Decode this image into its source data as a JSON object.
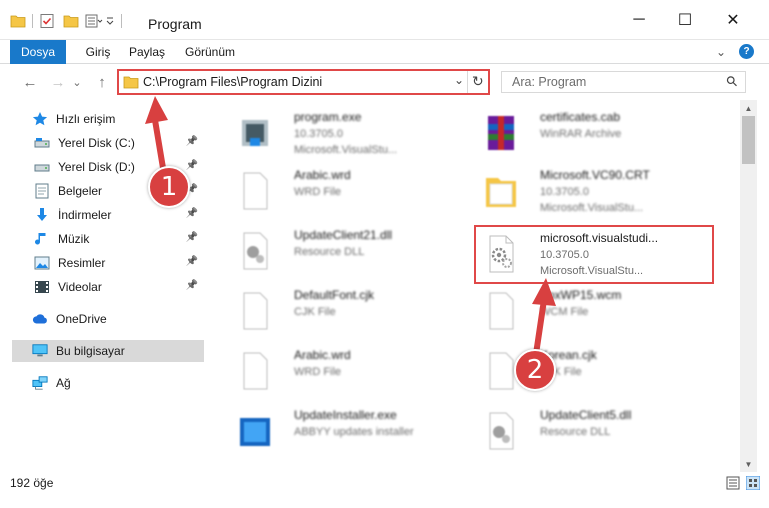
{
  "window": {
    "title": "Program",
    "minimize_glyph": "─",
    "maximize_glyph": "☐",
    "close_glyph": "✕"
  },
  "ribbon": {
    "tabs": [
      {
        "label": "Dosya"
      },
      {
        "label": "Giriş"
      },
      {
        "label": "Paylaş"
      },
      {
        "label": "Görünüm"
      }
    ],
    "help_glyph": "?",
    "collapse_glyph": "⌄"
  },
  "nav": {
    "back_glyph": "←",
    "forward_glyph": "→",
    "recent_glyph": "⌄",
    "up_glyph": "↑",
    "address": "C:\\Program Files\\Program Dizini",
    "dropdown_glyph": "⌄",
    "refresh_glyph": "↻",
    "search_placeholder": "Ara: Program",
    "search_glyph": "⚲"
  },
  "sidebar": {
    "quick_access": "Hızlı erişim",
    "items": [
      {
        "label": "Yerel Disk (C:)",
        "icon": "drive-icon"
      },
      {
        "label": "Yerel Disk (D:)",
        "icon": "drive-icon"
      },
      {
        "label": "Belgeler",
        "icon": "documents-icon"
      },
      {
        "label": "İndirmeler",
        "icon": "downloads-icon"
      },
      {
        "label": "Müzik",
        "icon": "music-icon"
      },
      {
        "label": "Resimler",
        "icon": "pictures-icon"
      },
      {
        "label": "Videolar",
        "icon": "videos-icon"
      }
    ],
    "onedrive": "OneDrive",
    "this_pc": "Bu bilgisayar",
    "network": "Ağ",
    "pin_glyph": "📌"
  },
  "files": [
    {
      "name": "program.exe",
      "line2": "10.3705.0",
      "line3": "Microsoft.VisualStu...",
      "icon": "exe-icon"
    },
    {
      "name": "certificates.cab",
      "line2": "WinRAR Archive",
      "line3": "",
      "icon": "archive-icon"
    },
    {
      "name": "Arabic.wrd",
      "line2": "WRD File",
      "line3": "",
      "icon": "file-icon"
    },
    {
      "name": "Microsoft.VC90.CRT",
      "line2": "10.3705.0",
      "line3": "Microsoft.VisualStu...",
      "icon": "folder-icon"
    },
    {
      "name": "UpdateClient21.dll",
      "line2": "Resource DLL",
      "line3": "",
      "icon": "dll-icon"
    },
    {
      "name": "microsoft.visualstudi...",
      "line2": "10.3705.0",
      "line3": "Microsoft.VisualStu...",
      "icon": "dll-icon"
    },
    {
      "name": "DefaultFont.cjk",
      "line2": "CJK File",
      "line3": "",
      "icon": "file-icon"
    },
    {
      "name": "BoxWP15.wcm",
      "line2": "WCM File",
      "line3": "",
      "icon": "file-icon"
    },
    {
      "name": "Arabic.wrd",
      "line2": "WRD File",
      "line3": "",
      "icon": "file-icon"
    },
    {
      "name": "Korean.cjk",
      "line2": "CJK File",
      "line3": "",
      "icon": "file-icon"
    },
    {
      "name": "UpdateInstaller.exe",
      "line2": "ABBYY updates installer",
      "line3": "",
      "icon": "installer-icon"
    },
    {
      "name": "UpdateClient5.dll",
      "line2": "Resource DLL",
      "line3": "",
      "icon": "dll-icon"
    }
  ],
  "status": {
    "count": "192 öğe"
  },
  "annotations": {
    "step1": "1",
    "step2": "2"
  },
  "colors": {
    "accent": "#1979ca",
    "highlight": "#e04848",
    "badge": "#d84040"
  }
}
